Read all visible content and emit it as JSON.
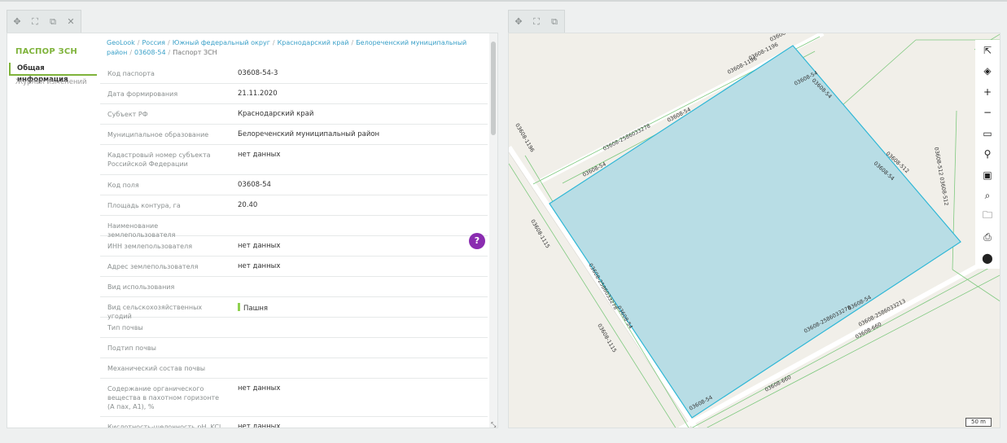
{
  "left_toolbar": {
    "icons": [
      "move-icon",
      "fullscreen-icon",
      "popout-icon",
      "close-icon"
    ]
  },
  "right_toolbar": {
    "icons": [
      "move-icon",
      "fullscreen-icon",
      "popout-icon"
    ]
  },
  "sidenav": {
    "title": "ПАСПОР ЗСН",
    "active": "Общая информация",
    "journal": "Журнал изменений"
  },
  "breadcrumb": {
    "items": [
      "GeoLook",
      "Россия",
      "Южный федеральный округ",
      "Краснодарский край",
      "Белореченский муниципальный район",
      "03608-54"
    ],
    "current": "Паспорт ЗСН"
  },
  "rows": [
    {
      "label": "Код паспорта",
      "value": "03608-54-3"
    },
    {
      "label": "Дата формирования",
      "value": "21.11.2020"
    },
    {
      "label": "Субъект РФ",
      "value": "Краснодарский край"
    },
    {
      "label": "Муниципальное образование",
      "value": "Белореченский муниципальный район"
    },
    {
      "label": "Кадастровый номер субъекта Российской Федерации",
      "value": "нет данных"
    },
    {
      "label": "Код поля",
      "value": "03608-54"
    },
    {
      "label": "Площадь контура, га",
      "value": "20.40"
    },
    {
      "label": "Наименование землепользователя",
      "value": ""
    },
    {
      "label": "ИНН землепользователя",
      "value": "нет данных"
    },
    {
      "label": "Адрес землепользователя",
      "value": "нет данных"
    },
    {
      "label": "Вид использования",
      "value": ""
    },
    {
      "label": "Вид сельскохозяйственных угодий",
      "value": "Пашня"
    },
    {
      "label": "Тип почвы",
      "value": ""
    },
    {
      "label": "Подтип почвы",
      "value": ""
    },
    {
      "label": "Механический состав почвы",
      "value": ""
    },
    {
      "label": "Содержание органического вещества в пахотном горизонте (А пах, А1), %",
      "value": "нет данных"
    },
    {
      "label": "Кислотность-щелочность pH, KCl",
      "value": "нет данных"
    }
  ],
  "help_button": "?",
  "map": {
    "labels": [
      "03608-1196",
      "03608-1196",
      "03608-54",
      "03608-1196",
      "03608-54",
      "03608-54",
      "03608-2586033278",
      "03608-54",
      "03608-512",
      "03608-54",
      "03608-512 03608-512",
      "03608-1196",
      "03608-1115",
      "03608-2586033278",
      "03608-54",
      "03608-1115",
      "03608-2586033278",
      "03608-54",
      "03608-660",
      "03608-2586033213",
      "03608-660",
      "03608-54"
    ],
    "tools": [
      "select-arrow-icon",
      "layers-icon",
      "zoom-in-icon",
      "zoom-out-icon",
      "ruler-icon",
      "pin-icon",
      "id-card-icon",
      "search-icon",
      "folder-icon",
      "print-icon",
      "location-icon"
    ],
    "tool_glyphs": [
      "⇱",
      "◈",
      "+",
      "−",
      "▭",
      "⚲",
      "▣",
      "⌕",
      "🗀",
      "⎙",
      "⬤"
    ],
    "scale": "50 m",
    "parcel_fill": "#b8dde5",
    "parcel_stroke": "#2fb7d6",
    "boundary_color": "#7fc97f"
  },
  "colors": {
    "accent": "#7fb33b",
    "link": "#3aa0c8",
    "help": "#8a2cb0"
  }
}
